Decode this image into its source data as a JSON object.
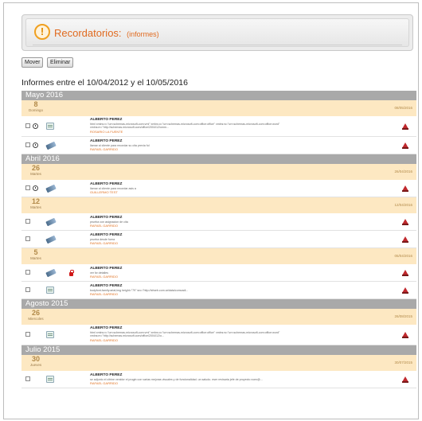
{
  "header": {
    "title": "Recordatorios:",
    "subtitle": "(informes)"
  },
  "toolbar": {
    "move_label": "Mover",
    "delete_label": "Eliminar"
  },
  "range_title": "Informes entre el 10/04/2012 y el 10/05/2016",
  "months": [
    {
      "label": "Mayo 2016",
      "days": [
        {
          "num": "8",
          "name": "Domingo",
          "date": "08/05/2016",
          "rows": [
            {
              "author": "ALBERTO PEREZ",
              "desc": [
                "html xmlns:v=\"urn:schemas-microsoft-com:vml\" xmlns:o=\"urn:schemas-microsoft-com:office:office\" xmlns:w=\"urn:schemas-microsoft-com:office:word\"",
                "xmlns:m=\"http://schemas.microsoft.com/office/2004/12/omm..."
              ],
              "user": "ROSARIO LA FUENTE",
              "icon": "doc",
              "clock": true,
              "lock": false
            },
            {
              "author": "ALBERTO PEREZ",
              "desc": [
                "llamar al cliente para recordar su cita previa ful"
              ],
              "user": "RAFAEL GARRIDO",
              "icon": "pen",
              "clock": true,
              "lock": false
            }
          ]
        }
      ]
    },
    {
      "label": "Abril 2016",
      "days": [
        {
          "num": "26",
          "name": "Martes",
          "date": "26/04/2016",
          "rows": [
            {
              "author": "ALBERTO PEREZ",
              "desc": [
                "llamar al cliente para recordar asis a"
              ],
              "user": "GUILLERMO TEST",
              "icon": "pen",
              "clock": true,
              "lock": false
            }
          ]
        },
        {
          "num": "12",
          "name": "Martes",
          "date": "12/04/2016",
          "rows": [
            {
              "author": "ALBERTO PEREZ",
              "desc": [
                "prueba con asignacion de cita"
              ],
              "user": "RAFAEL GARRIDO",
              "icon": "pen",
              "clock": false,
              "lock": false
            },
            {
              "author": "ALBERTO PEREZ",
              "desc": [
                "prueba desde fuera"
              ],
              "user": "RAFAEL GARRIDO",
              "icon": "pen",
              "clock": false,
              "lock": false
            }
          ]
        },
        {
          "num": "5",
          "name": "Martes",
          "date": "05/04/2016",
          "rows": [
            {
              "author": "ALBERTO PEREZ",
              "desc": [
                "ver fw detalles"
              ],
              "user": "RAFAEL GARRIDO",
              "icon": "pen",
              "clock": false,
              "lock": true
            },
            {
              "author": "ALBERTO PEREZ",
              "desc": [
                "bodyfont-family:arial;img height=\"79\" src=\"http://sfweb.com.ar/data/comcadi..."
              ],
              "user": "RAFAEL GARRIDO",
              "icon": "doc",
              "clock": false,
              "lock": false
            }
          ]
        }
      ]
    },
    {
      "label": "Agosto 2015",
      "days": [
        {
          "num": "26",
          "name": "Miercoles",
          "date": "26/08/2015",
          "rows": [
            {
              "author": "ALBERTO PEREZ",
              "desc": [
                "html xmlns:v=\"urn:schemas-microsoft-com:vml\" xmlns:o=\"urn:schemas-microsoft-com:office:office\" xmlns:w=\"urn:schemas-microsoft-com:office:word\"",
                "xmlns:m=\"http://schemas.microsoft.com/office/2004/12/o..."
              ],
              "user": "RAFAEL GARRIDO",
              "icon": "doc",
              "clock": false,
              "lock": false
            }
          ]
        }
      ]
    },
    {
      "label": "Julio 2015",
      "days": [
        {
          "num": "30",
          "name": "Jueves",
          "date": "30/07/2015",
          "rows": [
            {
              "author": "ALBERTO PEREZ",
              "desc": [
                "se adjunto el citrine venidor el prugin con varias mejoras visuales y de funcionalidad. un saludo. eser revisaria jefe de proyecto noex@..."
              ],
              "user": "RAFAEL GARRIDO",
              "icon": "doc",
              "clock": false,
              "lock": false
            }
          ]
        }
      ]
    }
  ]
}
